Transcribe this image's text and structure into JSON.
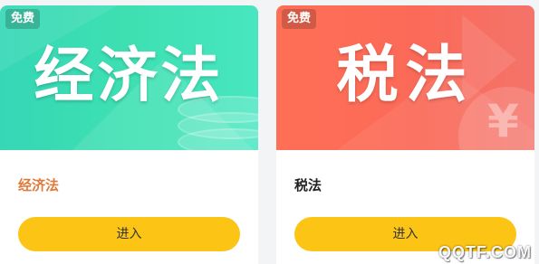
{
  "cards": [
    {
      "badge": "免费",
      "banner_title": "经济法",
      "name": "经济法",
      "button_label": "进入",
      "theme_color": "#3ee0b2",
      "name_color": "#e07a3c"
    },
    {
      "badge": "免费",
      "banner_title": "税法",
      "name": "税法",
      "button_label": "进入",
      "theme_color": "#fb6a58",
      "name_color": "#222222",
      "banner_icon": "yen-icon"
    }
  ],
  "button_color": "#fcc515",
  "watermark": "QQTF.COM"
}
